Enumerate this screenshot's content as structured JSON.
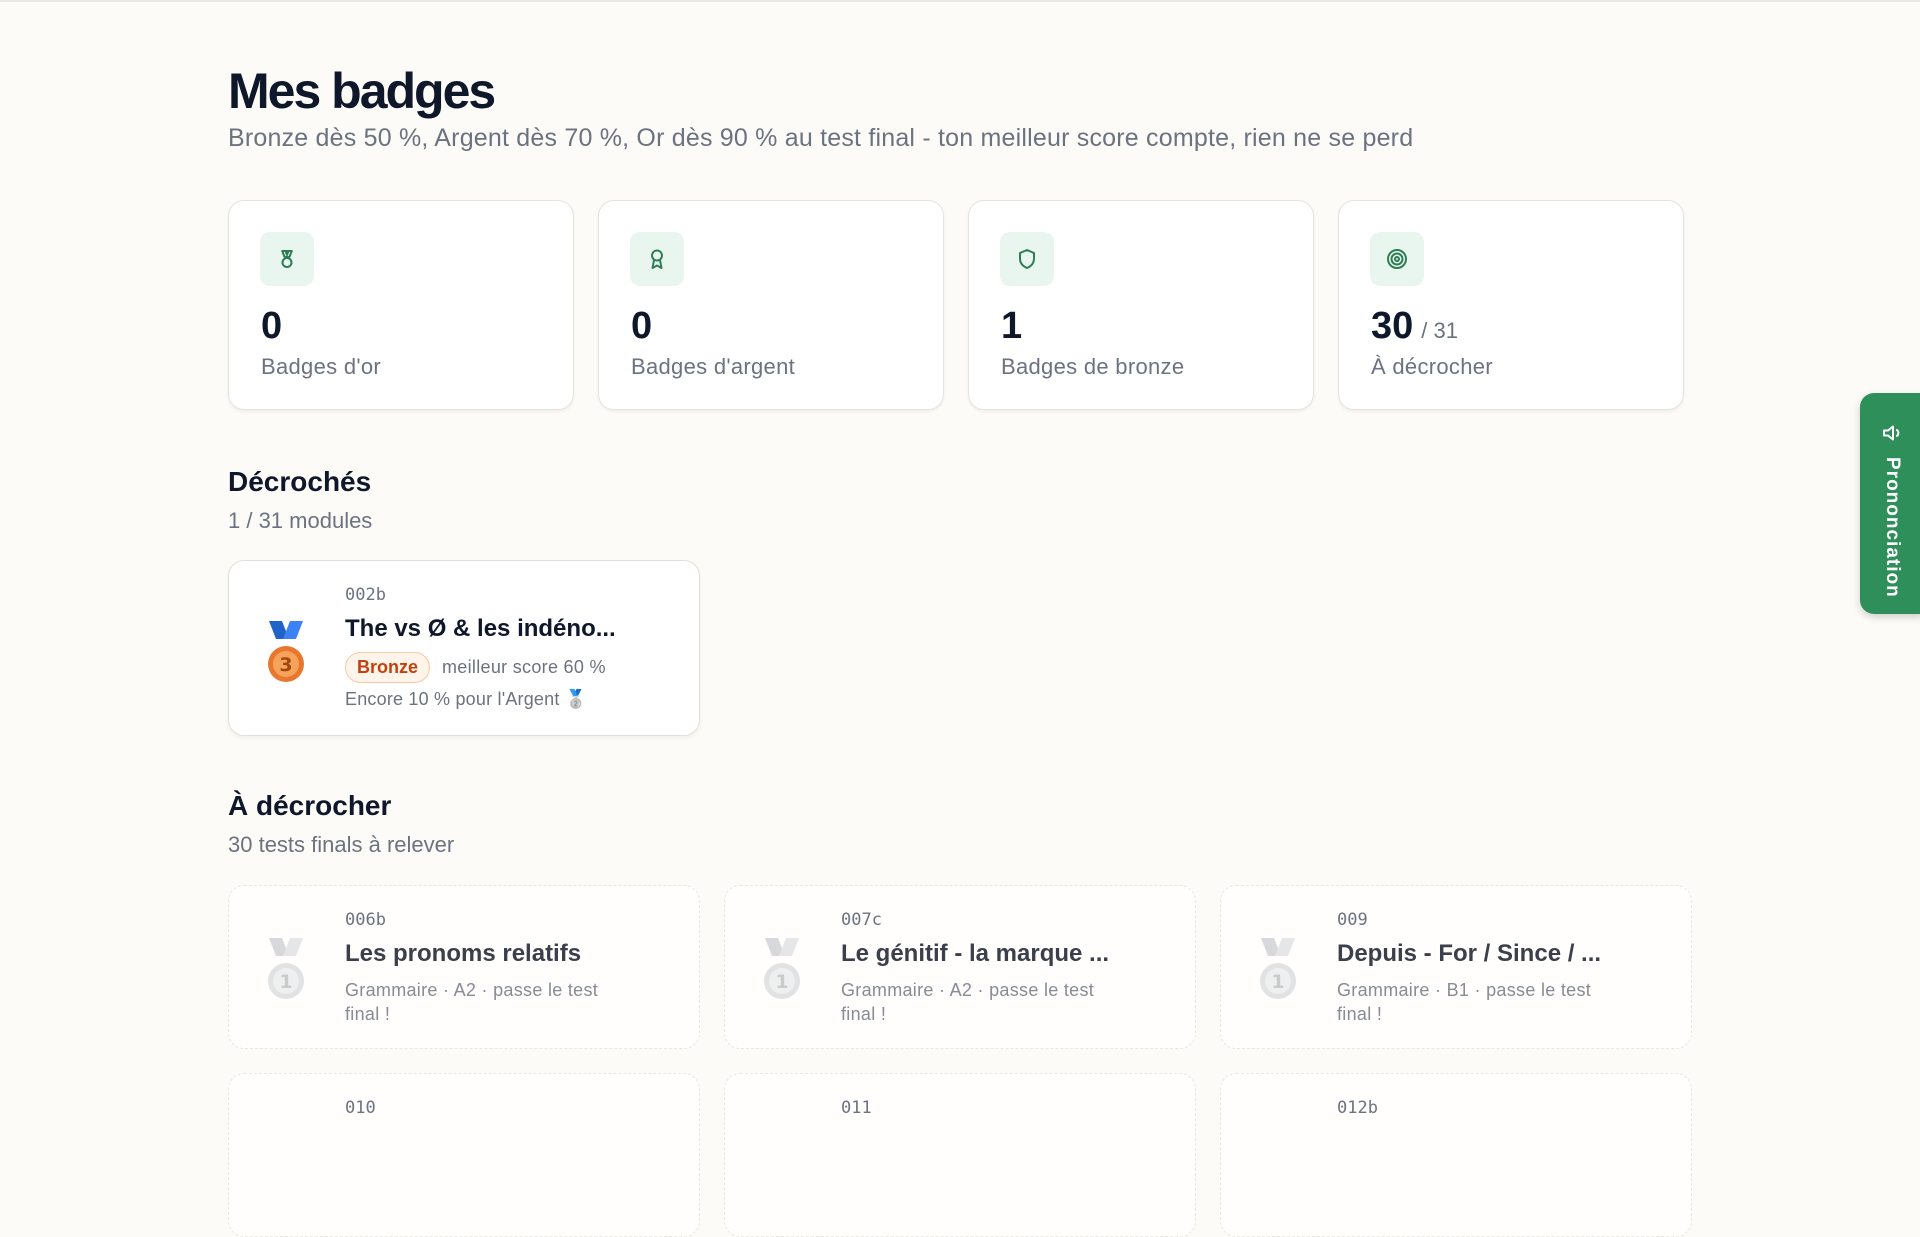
{
  "header": {
    "title": "Mes badges",
    "subtitle": "Bronze dès 50 %, Argent dès 70 %, Or dès 90 % au test final - ton meilleur score compte, rien ne se perd"
  },
  "stats": [
    {
      "icon": "medal-icon",
      "value": "0",
      "label": "Badges d'or"
    },
    {
      "icon": "award-icon",
      "value": "0",
      "label": "Badges d'argent"
    },
    {
      "icon": "shield-icon",
      "value": "1",
      "label": "Badges de bronze"
    },
    {
      "icon": "target-icon",
      "value": "30",
      "of": "/ 31",
      "label": "À décrocher"
    }
  ],
  "earned": {
    "title": "Décrochés",
    "subtitle": "1 / 31 modules",
    "items": [
      {
        "code": "002b",
        "name": "The vs Ø & les indéno...",
        "badge": "Bronze",
        "best": "meilleur score 60 %",
        "next": "Encore 10 % pour l'Argent 🥈"
      }
    ]
  },
  "todo": {
    "title": "À décrocher",
    "subtitle": "30 tests finals à relever",
    "items": [
      {
        "code": "006b",
        "name": "Les pronoms relatifs",
        "meta": "Grammaire · A2 · passe le test final !"
      },
      {
        "code": "007c",
        "name": "Le génitif - la marque ...",
        "meta": "Grammaire · A2 · passe le test final !"
      },
      {
        "code": "009",
        "name": "Depuis - For / Since / ...",
        "meta": "Grammaire · B1 · passe le test final !"
      },
      {
        "code": "010"
      },
      {
        "code": "011"
      },
      {
        "code": "012b"
      }
    ]
  },
  "side_tab": {
    "label": "Prononciation",
    "icon": "speaker-icon"
  },
  "colors": {
    "accent": "#2f8f5b",
    "bronze": "#c2410c",
    "icon_bg": "#e8f6ef"
  }
}
